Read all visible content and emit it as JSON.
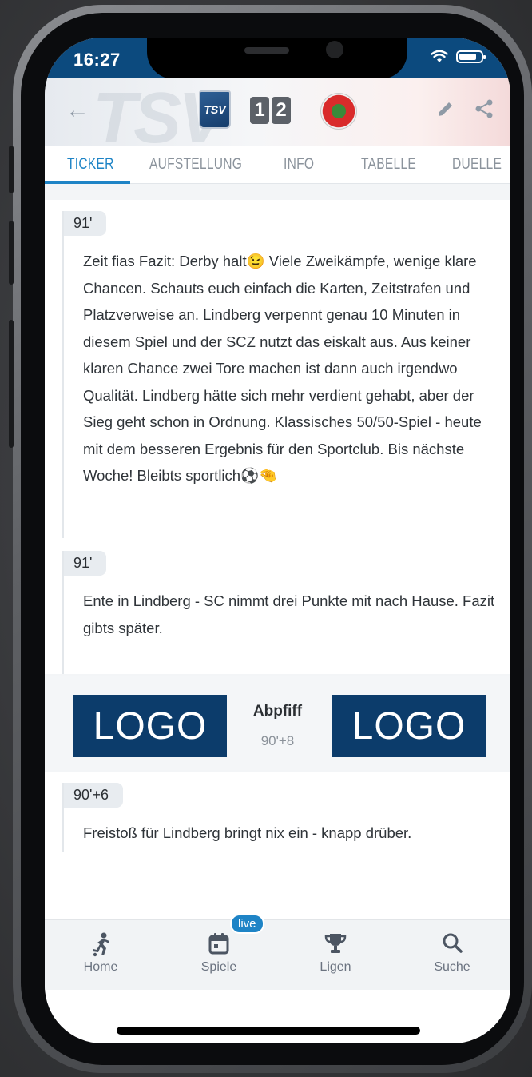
{
  "status": {
    "time": "16:27"
  },
  "header": {
    "home_crest_text": "TSV",
    "score_home": "1",
    "score_away": "2"
  },
  "tabs": [
    {
      "label": "TICKER",
      "active": true
    },
    {
      "label": "AUFSTELLUNG",
      "active": false
    },
    {
      "label": "INFO",
      "active": false
    },
    {
      "label": "TABELLE",
      "active": false
    },
    {
      "label": "DUELLE",
      "active": false
    }
  ],
  "ticker": [
    {
      "minute": "91'",
      "text": "Zeit fias Fazit: Derby halt😉 Viele Zweikämpfe, wenige klare Chancen. Schauts euch einfach die Karten, Zeitstrafen und Platzverweise an. Lindberg verpennt genau 10 Minuten in diesem Spiel und der SCZ nutzt das eiskalt aus. Aus keiner klaren Chance zwei Tore machen ist dann auch irgendwo Qualität. Lindberg hätte sich mehr verdient gehabt, aber der Sieg geht schon in Ordnung. Klassisches 50/50-Spiel - heute mit dem besseren Ergebnis für den Sportclub. Bis nächste Woche! Bleibts sportlich⚽🤏"
    },
    {
      "minute": "91'",
      "text": "Ente in Lindberg - SC nimmt drei Punkte mit nach Hause. Fazit gibts später."
    }
  ],
  "final_whistle": {
    "logo_left": "LOGO",
    "title": "Abpfiff",
    "minute": "90'+8",
    "logo_right": "LOGO"
  },
  "ticker_after": [
    {
      "minute": "90'+6",
      "text": "Freistoß für Lindberg bringt nix ein - knapp drüber."
    }
  ],
  "bottom_nav": {
    "badge": "live",
    "items": [
      {
        "label": "Home",
        "icon": "soccer-player-icon"
      },
      {
        "label": "Spiele",
        "icon": "calendar-icon"
      },
      {
        "label": "Ligen",
        "icon": "trophy-icon"
      },
      {
        "label": "Suche",
        "icon": "search-icon"
      }
    ]
  },
  "colors": {
    "accent": "#1e84c6",
    "statusbar": "#0c4a7e",
    "logo_box": "#0c3c6b"
  }
}
